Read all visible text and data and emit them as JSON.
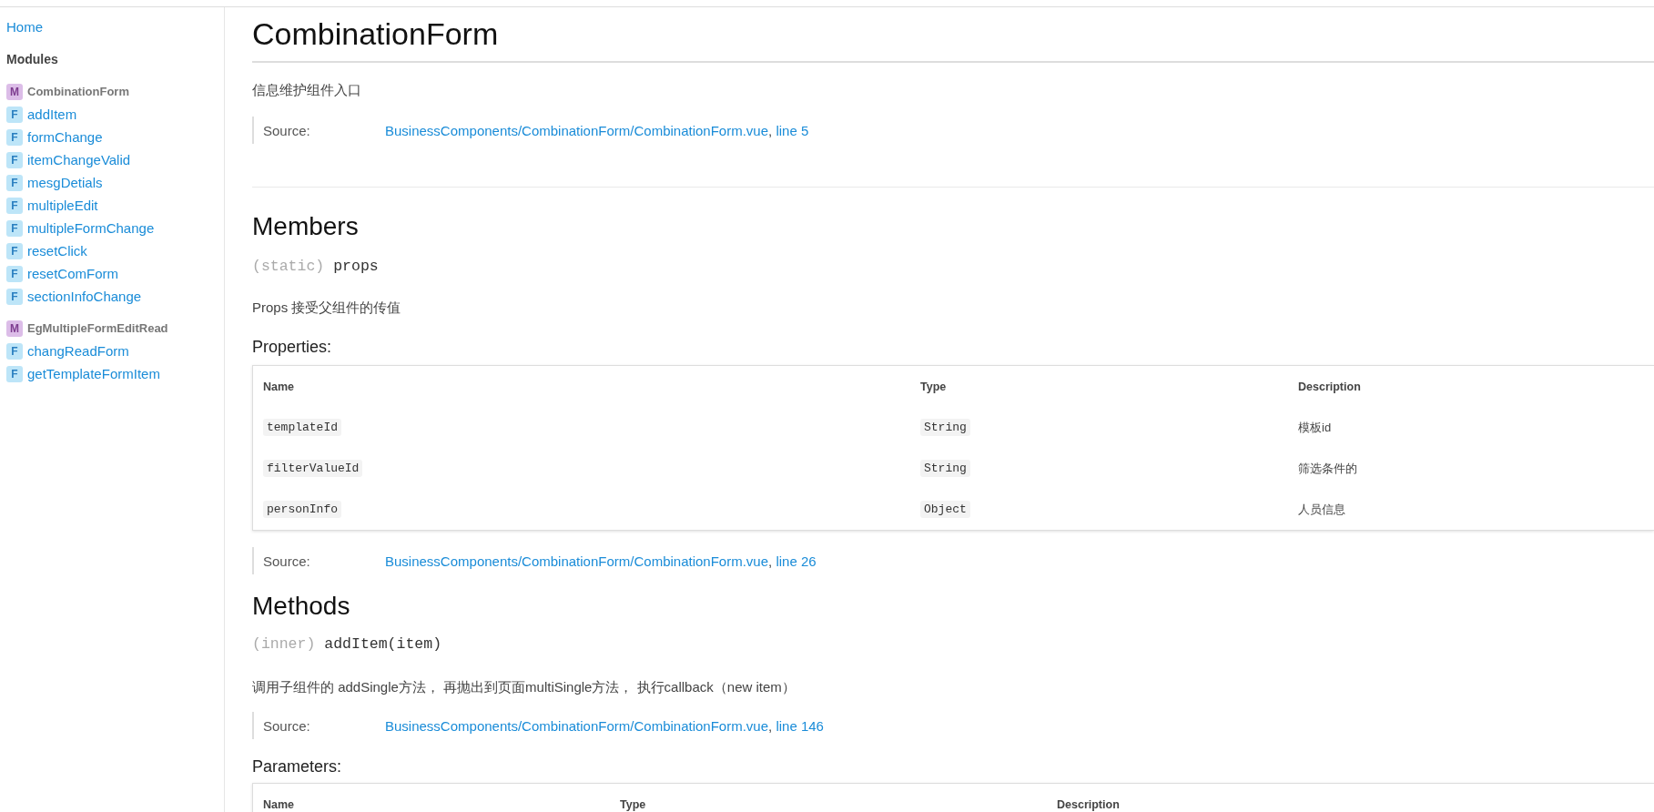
{
  "sidebar": {
    "home": "Home",
    "heading": "Modules",
    "modules": [
      {
        "kind": "module",
        "badge": "M",
        "name": "CombinationForm",
        "children": [
          {
            "kind": "function",
            "badge": "F",
            "name": "addItem"
          },
          {
            "kind": "function",
            "badge": "F",
            "name": "formChange"
          },
          {
            "kind": "function",
            "badge": "F",
            "name": "itemChangeValid"
          },
          {
            "kind": "function",
            "badge": "F",
            "name": "mesgDetials"
          },
          {
            "kind": "function",
            "badge": "F",
            "name": "multipleEdit"
          },
          {
            "kind": "function",
            "badge": "F",
            "name": "multipleFormChange"
          },
          {
            "kind": "function",
            "badge": "F",
            "name": "resetClick"
          },
          {
            "kind": "function",
            "badge": "F",
            "name": "resetComForm"
          },
          {
            "kind": "function",
            "badge": "F",
            "name": "sectionInfoChange"
          }
        ]
      },
      {
        "kind": "module",
        "badge": "M",
        "name": "EgMultipleFormEditRead",
        "children": [
          {
            "kind": "function",
            "badge": "F",
            "name": "changReadForm"
          },
          {
            "kind": "function",
            "badge": "F",
            "name": "getTemplateFormItem"
          }
        ]
      }
    ]
  },
  "page": {
    "title": "CombinationForm",
    "description": "信息维护组件入口",
    "source": {
      "label": "Source:",
      "file": "BusinessComponents/CombinationForm/CombinationForm.vue",
      "separator": ", ",
      "line": "line 5"
    }
  },
  "members": {
    "heading": "Members",
    "items": [
      {
        "scope": "(static)",
        "name": "props",
        "description": "Props 接受父组件的传值",
        "table_heading": "Properties:",
        "table": {
          "columns": [
            "Name",
            "Type",
            "Description"
          ],
          "rows": [
            {
              "name": "templateId",
              "type": "String",
              "description": "模板id"
            },
            {
              "name": "filterValueId",
              "type": "String",
              "description": "筛选条件的"
            },
            {
              "name": "personInfo",
              "type": "Object",
              "description": "人员信息"
            }
          ]
        },
        "source": {
          "label": "Source:",
          "file": "BusinessComponents/CombinationForm/CombinationForm.vue",
          "separator": ", ",
          "line": "line 26"
        }
      }
    ]
  },
  "methods": {
    "heading": "Methods",
    "items": [
      {
        "scope": "(inner)",
        "name": "addItem(item)",
        "description": "调用子组件的 addSingle方法， 再抛出到页面multiSingle方法， 执行callback（new item）",
        "source": {
          "label": "Source:",
          "file": "BusinessComponents/CombinationForm/CombinationForm.vue",
          "separator": ", ",
          "line": "line 146"
        },
        "table_heading": "Parameters:",
        "table": {
          "columns": [
            "Name",
            "Type",
            "Description"
          ]
        }
      }
    ]
  }
}
